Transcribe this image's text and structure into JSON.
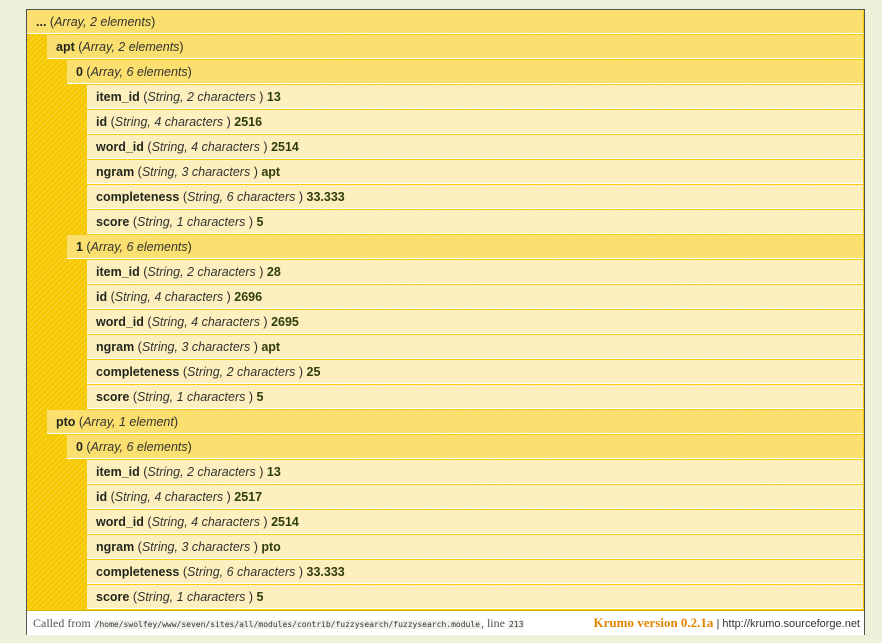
{
  "tree": {
    "nodes": [
      {
        "depth": 0,
        "kind": "array",
        "key": "...",
        "type": "Array, 2 elements"
      },
      {
        "depth": 1,
        "kind": "array",
        "key": "apt",
        "type": "Array, 2 elements"
      },
      {
        "depth": 2,
        "kind": "array",
        "key": "0",
        "type": "Array, 6 elements"
      },
      {
        "depth": 3,
        "kind": "string",
        "key": "item_id",
        "type": "String, 2 characters",
        "value": "13"
      },
      {
        "depth": 3,
        "kind": "string",
        "key": "id",
        "type": "String, 4 characters",
        "value": "2516"
      },
      {
        "depth": 3,
        "kind": "string",
        "key": "word_id",
        "type": "String, 4 characters",
        "value": "2514"
      },
      {
        "depth": 3,
        "kind": "string",
        "key": "ngram",
        "type": "String, 3 characters",
        "value": "apt"
      },
      {
        "depth": 3,
        "kind": "string",
        "key": "completeness",
        "type": "String, 6 characters",
        "value": "33.333"
      },
      {
        "depth": 3,
        "kind": "string",
        "key": "score",
        "type": "String, 1 characters",
        "value": "5"
      },
      {
        "depth": 2,
        "kind": "array",
        "key": "1",
        "type": "Array, 6 elements"
      },
      {
        "depth": 3,
        "kind": "string",
        "key": "item_id",
        "type": "String, 2 characters",
        "value": "28"
      },
      {
        "depth": 3,
        "kind": "string",
        "key": "id",
        "type": "String, 4 characters",
        "value": "2696"
      },
      {
        "depth": 3,
        "kind": "string",
        "key": "word_id",
        "type": "String, 4 characters",
        "value": "2695"
      },
      {
        "depth": 3,
        "kind": "string",
        "key": "ngram",
        "type": "String, 3 characters",
        "value": "apt"
      },
      {
        "depth": 3,
        "kind": "string",
        "key": "completeness",
        "type": "String, 2 characters",
        "value": "25"
      },
      {
        "depth": 3,
        "kind": "string",
        "key": "score",
        "type": "String, 1 characters",
        "value": "5"
      },
      {
        "depth": 1,
        "kind": "array",
        "key": "pto",
        "type": "Array, 1 element"
      },
      {
        "depth": 2,
        "kind": "array",
        "key": "0",
        "type": "Array, 6 elements"
      },
      {
        "depth": 3,
        "kind": "string",
        "key": "item_id",
        "type": "String, 2 characters",
        "value": "13"
      },
      {
        "depth": 3,
        "kind": "string",
        "key": "id",
        "type": "String, 4 characters",
        "value": "2517"
      },
      {
        "depth": 3,
        "kind": "string",
        "key": "word_id",
        "type": "String, 4 characters",
        "value": "2514"
      },
      {
        "depth": 3,
        "kind": "string",
        "key": "ngram",
        "type": "String, 3 characters",
        "value": "pto"
      },
      {
        "depth": 3,
        "kind": "string",
        "key": "completeness",
        "type": "String, 6 characters",
        "value": "33.333"
      },
      {
        "depth": 3,
        "kind": "string",
        "key": "score",
        "type": "String, 1 characters",
        "value": "5"
      }
    ]
  },
  "footer": {
    "called_from_label": "Called from",
    "file_path": "/home/swolfey/www/seven/sites/all/modules/contrib/fuzzysearch/fuzzysearch.module",
    "line_label": ", line",
    "line_number": "213",
    "version_label": "Krumo version 0.2.1a",
    "separator": "|",
    "site_link": "http://krumo.sourceforge.net"
  },
  "colors": {
    "tree_background": "#f6c800",
    "array_row": "#fbdf6f",
    "string_row": "#fdf0be",
    "version_text": "#e28500"
  }
}
